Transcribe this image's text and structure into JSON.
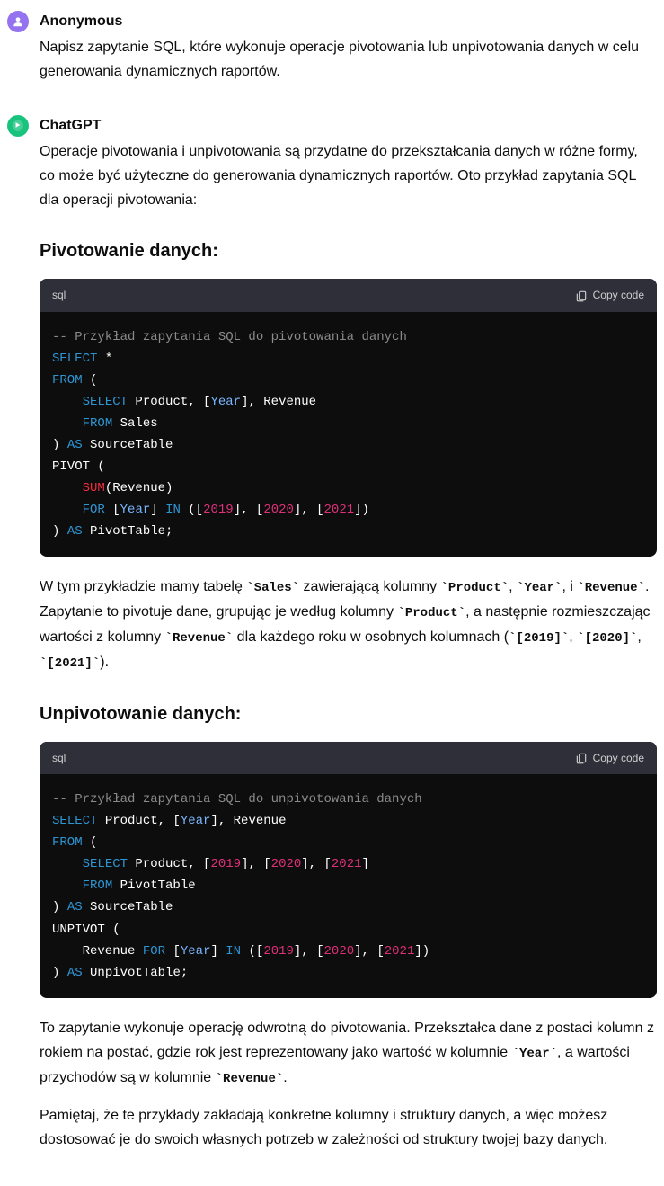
{
  "messages": {
    "user": {
      "author": "Anonymous",
      "text": "Napisz zapytanie SQL, które wykonuje operacje pivotowania lub unpivotowania danych w celu generowania dynamicznych raportów."
    },
    "bot": {
      "author": "ChatGPT",
      "intro": "Operacje pivotowania i unpivotowania są przydatne do przekształcania danych w różne formy, co może być użyteczne do generowania dynamicznych raportów. Oto przykład zapytania SQL dla operacji pivotowania:",
      "h1": "Pivotowanie danych:",
      "code1": {
        "lang": "sql",
        "copy": "Copy code",
        "c_comment": "-- Przykład zapytania SQL do pivotowania danych",
        "kw_select": "SELECT",
        "star": " *",
        "kw_from": "FROM",
        "lpar": " (",
        "inner_select": "SELECT",
        "inner_cols_a": " Product, [",
        "inner_year": "Year",
        "inner_cols_b": "], Revenue",
        "inner_from": "FROM",
        "inner_table": " Sales",
        "close1": ") ",
        "kw_as1": "AS",
        "src": " SourceTable",
        "pivot_open": "PIVOT (",
        "sum": "SUM",
        "sum_arg": "(Revenue)",
        "kw_for": "FOR",
        "for_a": " [",
        "for_year": "Year",
        "for_b": "] ",
        "kw_in": "IN",
        "in_a": " ([",
        "y2019": "2019",
        "in_b": "], [",
        "y2020": "2020",
        "in_c": "], [",
        "y2021": "2021",
        "in_d": "])",
        "close2": ") ",
        "kw_as2": "AS",
        "pivottab": " PivotTable;"
      },
      "para2_a": "W tym przykładzie mamy tabelę ",
      "para2_c1": "Sales",
      "para2_b": " zawierającą kolumny ",
      "para2_c2": "Product",
      "para2_c": ", ",
      "para2_c3": "Year",
      "para2_d": ", i ",
      "para2_c4": "Revenue",
      "para2_e": ". Zapytanie to pivotuje dane, grupując je według kolumny ",
      "para2_c5": "Product",
      "para2_f": ", a następnie rozmieszczając wartości z kolumny ",
      "para2_c6": "Revenue",
      "para2_g": " dla każdego roku w osobnych kolumnach (",
      "para2_c7": "[2019]",
      "para2_h": ", ",
      "para2_c8": "[2020]",
      "para2_i": ", ",
      "para2_c9": "[2021]",
      "para2_j": ").",
      "h2": "Unpivotowanie danych:",
      "code2": {
        "lang": "sql",
        "copy": "Copy code",
        "c_comment": "-- Przykład zapytania SQL do unpivotowania danych",
        "kw_select": "SELECT",
        "sel_a": " Product, [",
        "sel_year": "Year",
        "sel_b": "], Revenue",
        "kw_from": "FROM",
        "lpar": " (",
        "inner_select": "SELECT",
        "inner_a": " Product, [",
        "y2019": "2019",
        "inner_b": "], [",
        "y2020": "2020",
        "inner_c": "], [",
        "y2021": "2021",
        "inner_d": "]",
        "inner_from": "FROM",
        "inner_table": " PivotTable",
        "close1": ") ",
        "kw_as1": "AS",
        "src": " SourceTable",
        "unpivot_open": "UNPIVOT (",
        "rev": "    Revenue ",
        "kw_for": "FOR",
        "for_a": " [",
        "for_year": "Year",
        "for_b": "] ",
        "kw_in": "IN",
        "in_a": " ([",
        "iy2019": "2019",
        "in_b": "], [",
        "iy2020": "2020",
        "in_c": "], [",
        "iy2021": "2021",
        "in_d": "])",
        "close2": ") ",
        "kw_as2": "AS",
        "untab": " UnpivotTable;"
      },
      "para3_a": "To zapytanie wykonuje operację odwrotną do pivotowania. Przekształca dane z postaci kolumn z rokiem na postać, gdzie rok jest reprezentowany jako wartość w kolumnie ",
      "para3_c1": "Year",
      "para3_b": ", a wartości przychodów są w kolumnie ",
      "para3_c2": "Revenue",
      "para3_c": ".",
      "para4": "Pamiętaj, że te przykłady zakładają konkretne kolumny i struktury danych, a więc możesz dostosować je do swoich własnych potrzeb w zależności od struktury twojej bazy danych."
    }
  }
}
